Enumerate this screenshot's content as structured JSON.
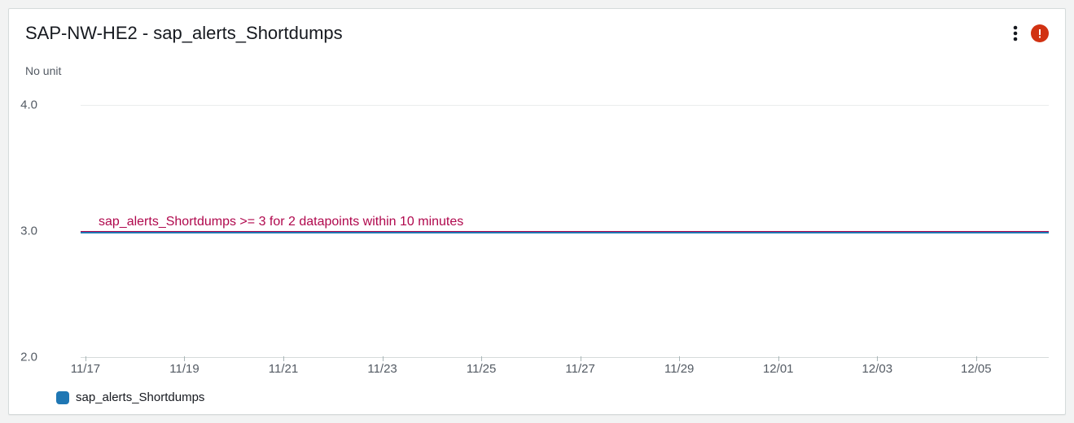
{
  "card": {
    "title": "SAP-NW-HE2 - sap_alerts_Shortdumps",
    "unit_label": "No unit"
  },
  "legend": {
    "series_name": "sap_alerts_Shortdumps",
    "series_color": "#1f77b4"
  },
  "alert": {
    "status_color": "#d13212"
  },
  "chart_data": {
    "type": "line",
    "title": "SAP-NW-HE2 - sap_alerts_Shortdumps",
    "ylabel": "No unit",
    "xlabel": "",
    "ylim": [
      2.0,
      4.0
    ],
    "y_ticks": [
      2.0,
      3.0,
      4.0
    ],
    "x_categories": [
      "11/17",
      "11/19",
      "11/21",
      "11/23",
      "11/25",
      "11/27",
      "11/29",
      "12/01",
      "12/03",
      "12/05"
    ],
    "series": [
      {
        "name": "sap_alerts_Shortdumps",
        "color": "#1f77b4",
        "x": [
          "11/17",
          "11/19",
          "11/21",
          "11/23",
          "11/25",
          "11/27",
          "11/29",
          "12/01",
          "12/03",
          "12/05"
        ],
        "y": [
          3.0,
          3.0,
          3.0,
          3.0,
          3.0,
          3.0,
          3.0,
          3.0,
          3.0,
          3.0
        ]
      }
    ],
    "threshold": {
      "label": "sap_alerts_Shortdumps >= 3 for 2 datapoints within 10 minutes",
      "value": 3.0,
      "color": "#b0084d"
    }
  }
}
